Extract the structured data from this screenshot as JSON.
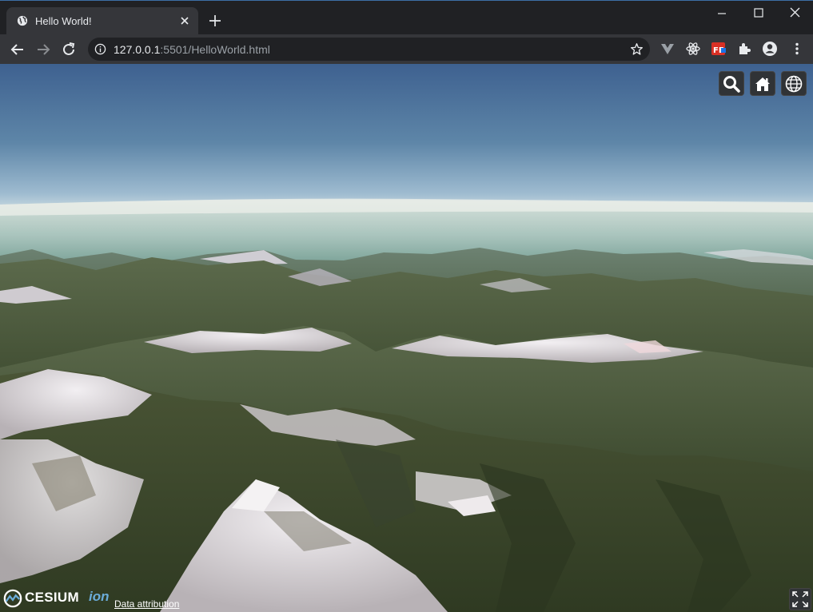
{
  "browser": {
    "tab": {
      "title": "Hello World!",
      "favicon": "globe-icon"
    },
    "url": {
      "host": "127.0.0.1",
      "rest": ":5501/HelloWorld.html"
    },
    "extensions": [
      "vuejs-devtools-icon",
      "react-devtools-icon",
      "fehelper-icon",
      "extensions-puzzle-icon",
      "profile-icon",
      "menu-dots-icon"
    ],
    "fe_badge": "FE"
  },
  "cesium": {
    "toolbar": [
      "search-icon",
      "home-icon",
      "globe-icon"
    ],
    "credit": {
      "brand": "CESIUM",
      "ion": "ion"
    },
    "data_attribution": "Data attribution",
    "fullscreen": "fullscreen-icon"
  },
  "colors": {
    "tab_strip": "#202124",
    "toolbar": "#35363a",
    "sky_top": "#3e6190",
    "sky_horizon": "#b9cfdc",
    "cesium_button": "#303336"
  }
}
